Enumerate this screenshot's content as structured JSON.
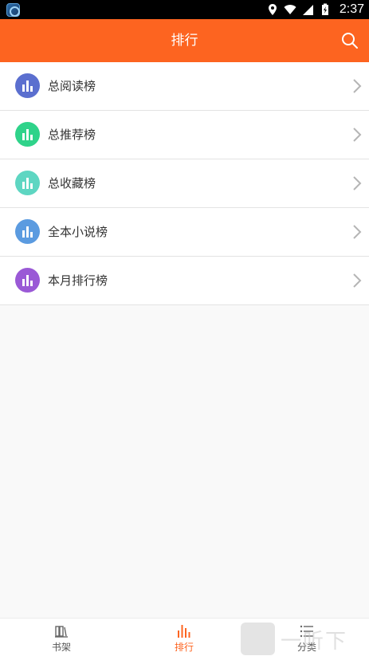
{
  "status_bar": {
    "time": "2:37",
    "icons": [
      "app-icon",
      "location-icon",
      "wifi-icon",
      "signal-icon",
      "battery-icon"
    ]
  },
  "app_bar": {
    "title": "排行",
    "search_icon": "search-icon",
    "background": "#fd6420"
  },
  "rankings": [
    {
      "label": "总阅读榜",
      "icon": "bar-chart-icon",
      "color": "#5b6fcf"
    },
    {
      "label": "总推荐榜",
      "icon": "bar-chart-icon",
      "color": "#2fd38a"
    },
    {
      "label": "总收藏榜",
      "icon": "bar-chart-icon",
      "color": "#5ed6c2"
    },
    {
      "label": "全本小说榜",
      "icon": "bar-chart-icon",
      "color": "#5b9be0"
    },
    {
      "label": "本月排行榜",
      "icon": "bar-chart-icon",
      "color": "#9a59d6"
    }
  ],
  "tabs": [
    {
      "label": "书架",
      "icon": "bookshelf-icon",
      "active": false
    },
    {
      "label": "排行",
      "icon": "ranking-icon",
      "active": true
    },
    {
      "label": "分类",
      "icon": "list-icon",
      "active": false
    }
  ],
  "watermark": {
    "text": "一听下载"
  },
  "colors": {
    "accent": "#fd6420",
    "inactive_tab": "#555555",
    "divider": "#e3e3e3"
  }
}
